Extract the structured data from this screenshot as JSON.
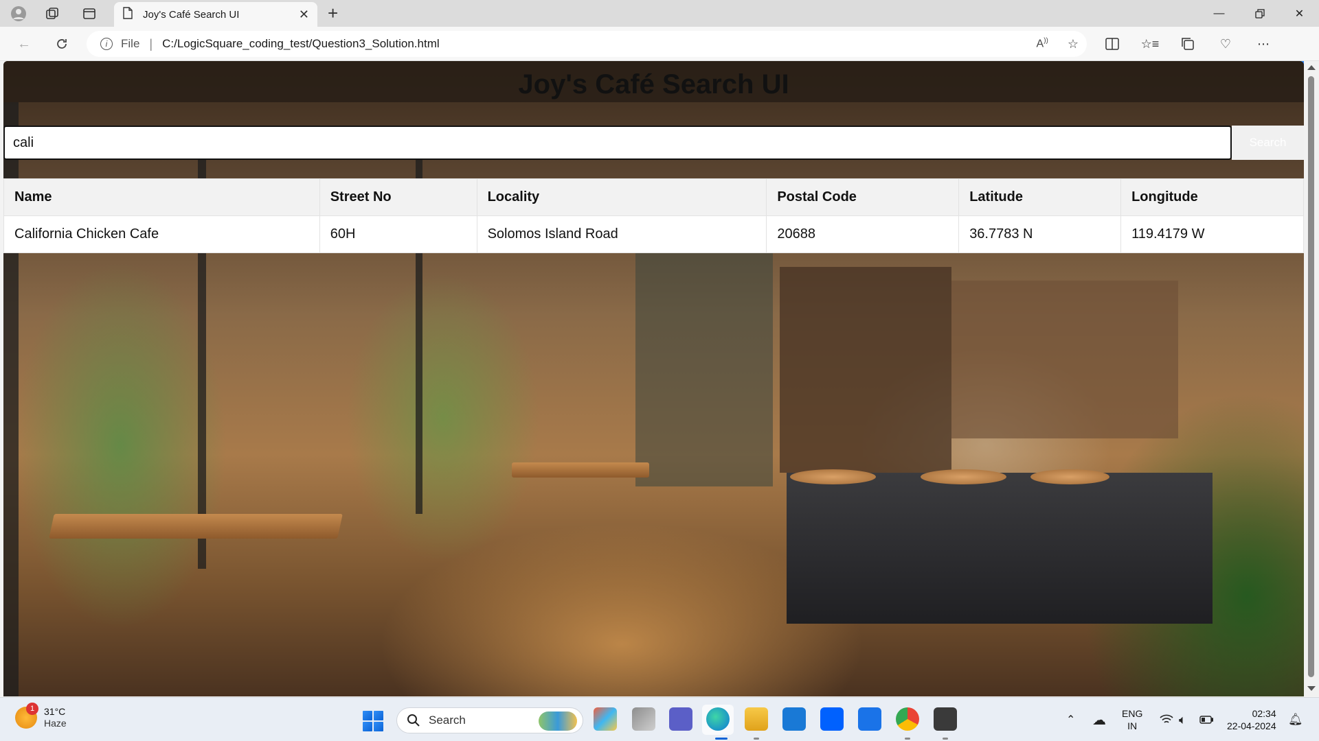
{
  "browser": {
    "tab_title": "Joy's Café Search UI",
    "address_scheme_label": "File",
    "url": "C:/LogicSquare_coding_test/Question3_Solution.html"
  },
  "page": {
    "title": "Joy's Café Search UI",
    "search": {
      "value": "cali",
      "button_label": "Search"
    },
    "table": {
      "headers": [
        "Name",
        "Street No",
        "Locality",
        "Postal Code",
        "Latitude",
        "Longitude"
      ],
      "rows": [
        [
          "California Chicken Cafe",
          "60H",
          "Solomos Island Road",
          "20688",
          "36.7783 N",
          "119.4179 W"
        ]
      ]
    }
  },
  "taskbar": {
    "weather_temp": "31°C",
    "weather_condition": "Haze",
    "weather_badge": "1",
    "search_label": "Search",
    "language": "ENG",
    "region": "IN",
    "time": "02:34",
    "date": "22-04-2024"
  }
}
